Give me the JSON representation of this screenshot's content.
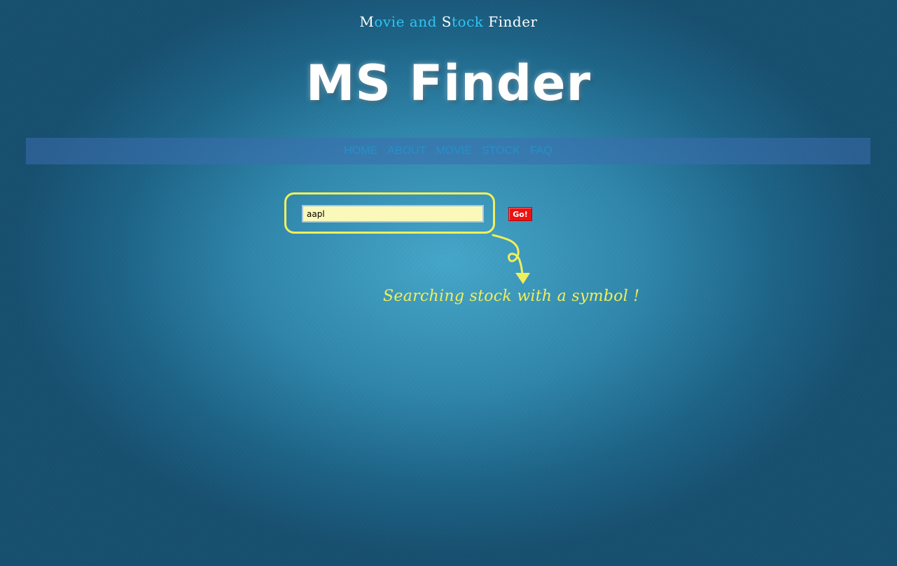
{
  "header": {
    "tagline_parts": [
      "M",
      "ovie and ",
      "S",
      "tock ",
      "Finder"
    ],
    "title": "MS Finder"
  },
  "nav": {
    "items": [
      "HOME",
      "ABOUT",
      "MOVIE",
      "STOCK",
      "FAQ"
    ]
  },
  "search": {
    "value": "aapl",
    "button_label": "Go!"
  },
  "annotation": {
    "text": "Searching stock with a symbol !"
  },
  "colors": {
    "accent_yellow": "#f1ef5a",
    "go_button_red": "#ee1111",
    "tagline_cyan": "#2fc4f2",
    "nav_link": "#2590c7"
  }
}
